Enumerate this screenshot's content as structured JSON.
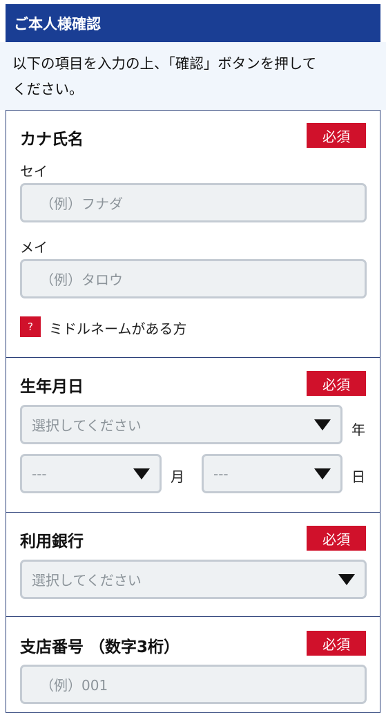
{
  "header": {
    "title": "ご本人様確認"
  },
  "intro": {
    "line1": "以下の項目を入力の上、「確認」ボタンを押して",
    "line2": "ください。"
  },
  "required_badge": "必須",
  "kana_name": {
    "title": "カナ氏名",
    "sei_label": "セイ",
    "sei_placeholder": "（例）フナダ",
    "mei_label": "メイ",
    "mei_placeholder": "（例）タロウ",
    "help_icon": "?",
    "middle_name_link": "ミドルネームがある方"
  },
  "birthdate": {
    "title": "生年月日",
    "year_value": "選択してください",
    "year_unit": "年",
    "month_value": "---",
    "month_unit": "月",
    "day_value": "---",
    "day_unit": "日"
  },
  "bank": {
    "title": "利用銀行",
    "select_value": "選択してください"
  },
  "branch": {
    "title": "支店番号 （数字3桁）",
    "placeholder": "（例）001"
  },
  "colors": {
    "header_bg": "#1a3e94",
    "badge_bg": "#d0112b",
    "intro_bg": "#f1f6fc",
    "field_bg": "#eef1f3"
  },
  "icons": {
    "select_arrow": "triangle-down-icon",
    "help": "question-icon"
  }
}
